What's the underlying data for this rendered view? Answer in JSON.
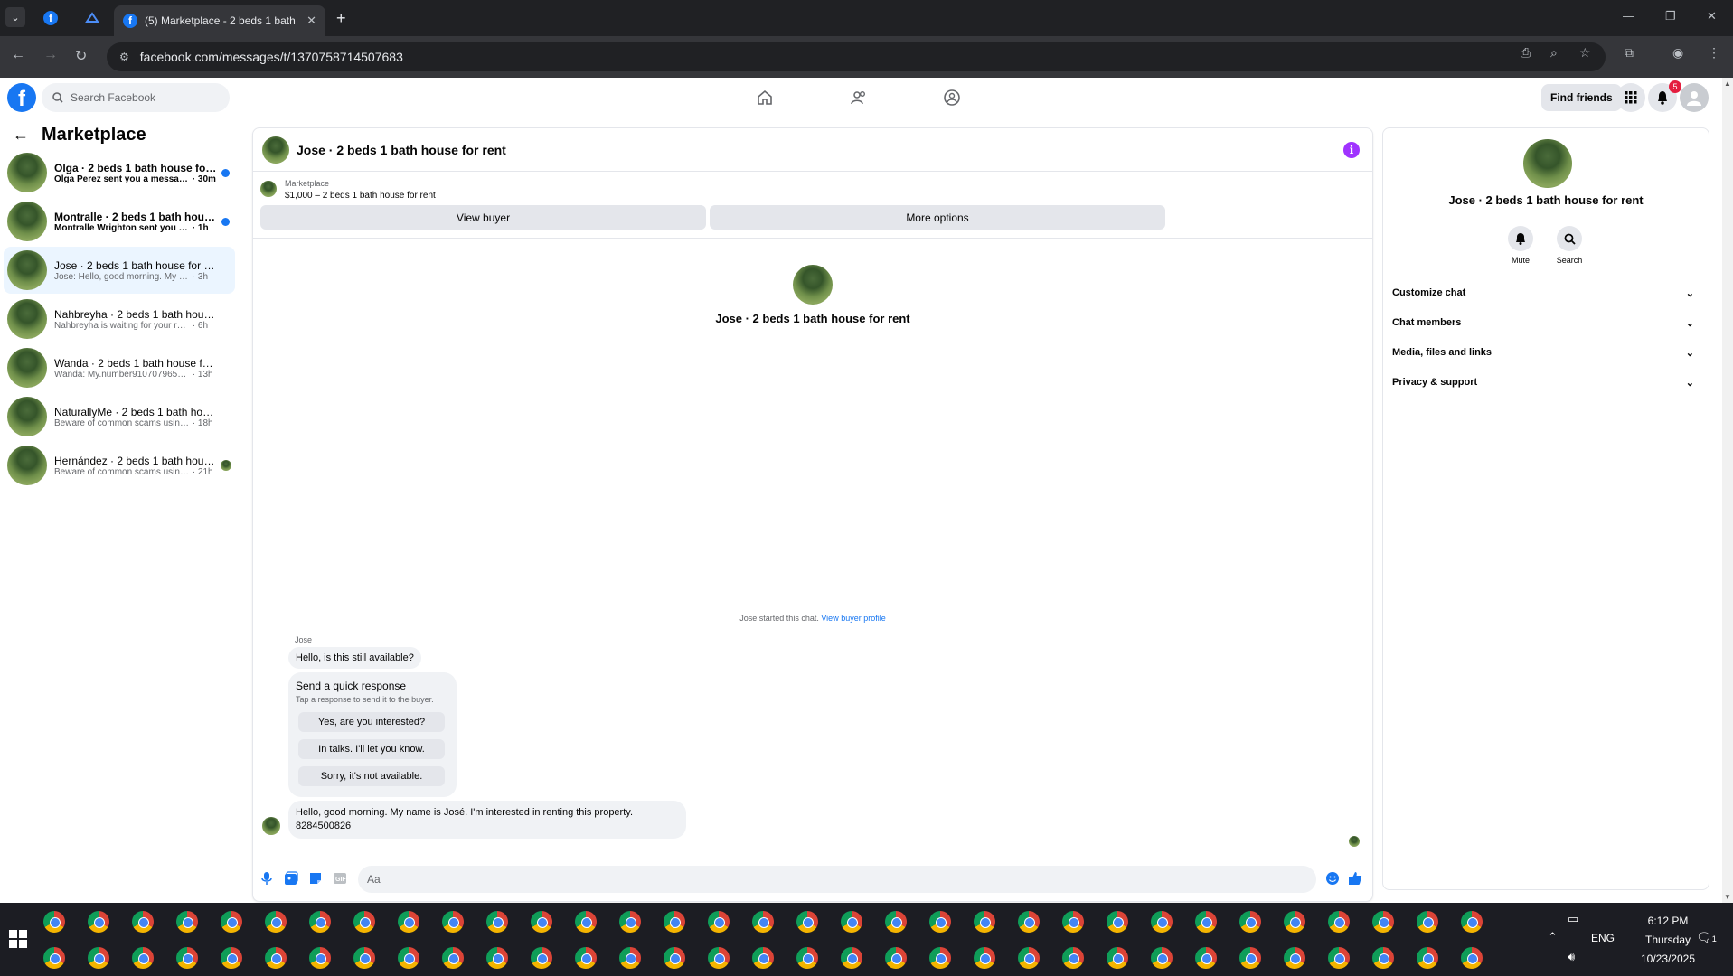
{
  "browser": {
    "tab_title": "(5) Marketplace - 2 beds 1 bath",
    "url": "facebook.com/messages/t/1370758714507683"
  },
  "header": {
    "search_placeholder": "Search Facebook",
    "find_friends": "Find friends",
    "notification_count": "5"
  },
  "sidebar": {
    "title": "Marketplace",
    "conversations": [
      {
        "name": "Olga · 2 beds 1 bath house for rent",
        "snippet": "Olga Perez sent you a message a...",
        "time": "30m",
        "unread": true
      },
      {
        "name": "Montralle · 2 beds 1 bath house f...",
        "snippet": "Montralle Wrighton sent you a me...",
        "time": "1h",
        "unread": true
      },
      {
        "name": "Jose · 2 beds 1 bath house for rent",
        "snippet": "Jose: Hello, good morning. My name i...",
        "time": "3h",
        "unread": false
      },
      {
        "name": "Nahbreyha · 2 beds 1 bath house f...",
        "snippet": "Nahbreyha is waiting for your respon...",
        "time": "6h",
        "unread": false
      },
      {
        "name": "Wanda · 2 beds 1 bath house for re...",
        "snippet": "Wanda: My.number9107079651.ask.f...",
        "time": "13h",
        "unread": false
      },
      {
        "name": "NaturallyMe · 2 beds 1 bath house ...",
        "snippet": "Beware of common scams using pay...",
        "time": "18h",
        "unread": false
      },
      {
        "name": "Hernández · 2 beds 1 bath hous...",
        "snippet": "Beware of common scams using ...",
        "time": "21h",
        "unread": false
      }
    ]
  },
  "chat": {
    "title": "Jose · 2 beds 1 bath house for rent",
    "listing_kicker": "Marketplace",
    "listing_price": "$1,000 – 2 beds 1 bath house for rent",
    "view_buyer": "View buyer",
    "more_options": "More options",
    "intro_name": "Jose · 2 beds 1 bath house for rent",
    "system_text": "Jose started this chat.",
    "system_link": "View buyer profile",
    "sender": "Jose",
    "msg1": "Hello, is this still available?",
    "quick_title": "Send a quick response",
    "quick_sub": "Tap a response to send it to the buyer.",
    "quick_responses": [
      "Yes, are you interested?",
      "In talks. I'll let you know.",
      "Sorry, it's not available."
    ],
    "msg2_line1": "Hello, good morning. My name is José. I'm interested in renting this property.",
    "msg2_line2": "8284500826",
    "composer_placeholder": "Aa"
  },
  "details": {
    "name": "Jose · 2 beds 1 bath house for rent",
    "mute": "Mute",
    "search": "Search",
    "sections": [
      "Customize chat",
      "Chat members",
      "Media, files and links",
      "Privacy & support"
    ]
  },
  "taskbar": {
    "time": "6:12 PM",
    "day": "Thursday",
    "date": "10/23/2025",
    "lang": "ENG",
    "notif": "1"
  },
  "colors": {
    "brand": "#1877f2",
    "unread_dot": "#1877f2",
    "info": "#a033ff",
    "badge": "#e41e3f"
  }
}
